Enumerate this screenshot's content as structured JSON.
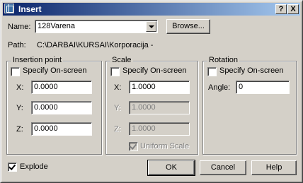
{
  "window": {
    "title": "Insert",
    "help_label": "?",
    "close_label": "X"
  },
  "name": {
    "label": "Name:",
    "value": "128Varena",
    "browse_label": "Browse..."
  },
  "path": {
    "label": "Path:",
    "value": "C:\\DARBAI\\KURSAI\\Korporacija -"
  },
  "insertion": {
    "title": "Insertion point",
    "specify_label": "Specify On-screen",
    "specify_checked": false,
    "x_label": "X:",
    "x_value": "0.0000",
    "y_label": "Y:",
    "y_value": "0.0000",
    "z_label": "Z:",
    "z_value": "0.0000"
  },
  "scale": {
    "title": "Scale",
    "specify_label": "Specify On-screen",
    "specify_checked": false,
    "x_label": "X:",
    "x_value": "1.0000",
    "y_label": "Y:",
    "y_value": "1.0000",
    "z_label": "Z:",
    "z_value": "1.0000",
    "uniform_label": "Uniform Scale",
    "uniform_checked": true
  },
  "rotation": {
    "title": "Rotation",
    "specify_label": "Specify On-screen",
    "specify_checked": false,
    "angle_label": "Angle:",
    "angle_value": "0"
  },
  "explode": {
    "label": "Explode",
    "checked": true
  },
  "buttons": {
    "ok": "OK",
    "cancel": "Cancel",
    "help": "Help"
  }
}
